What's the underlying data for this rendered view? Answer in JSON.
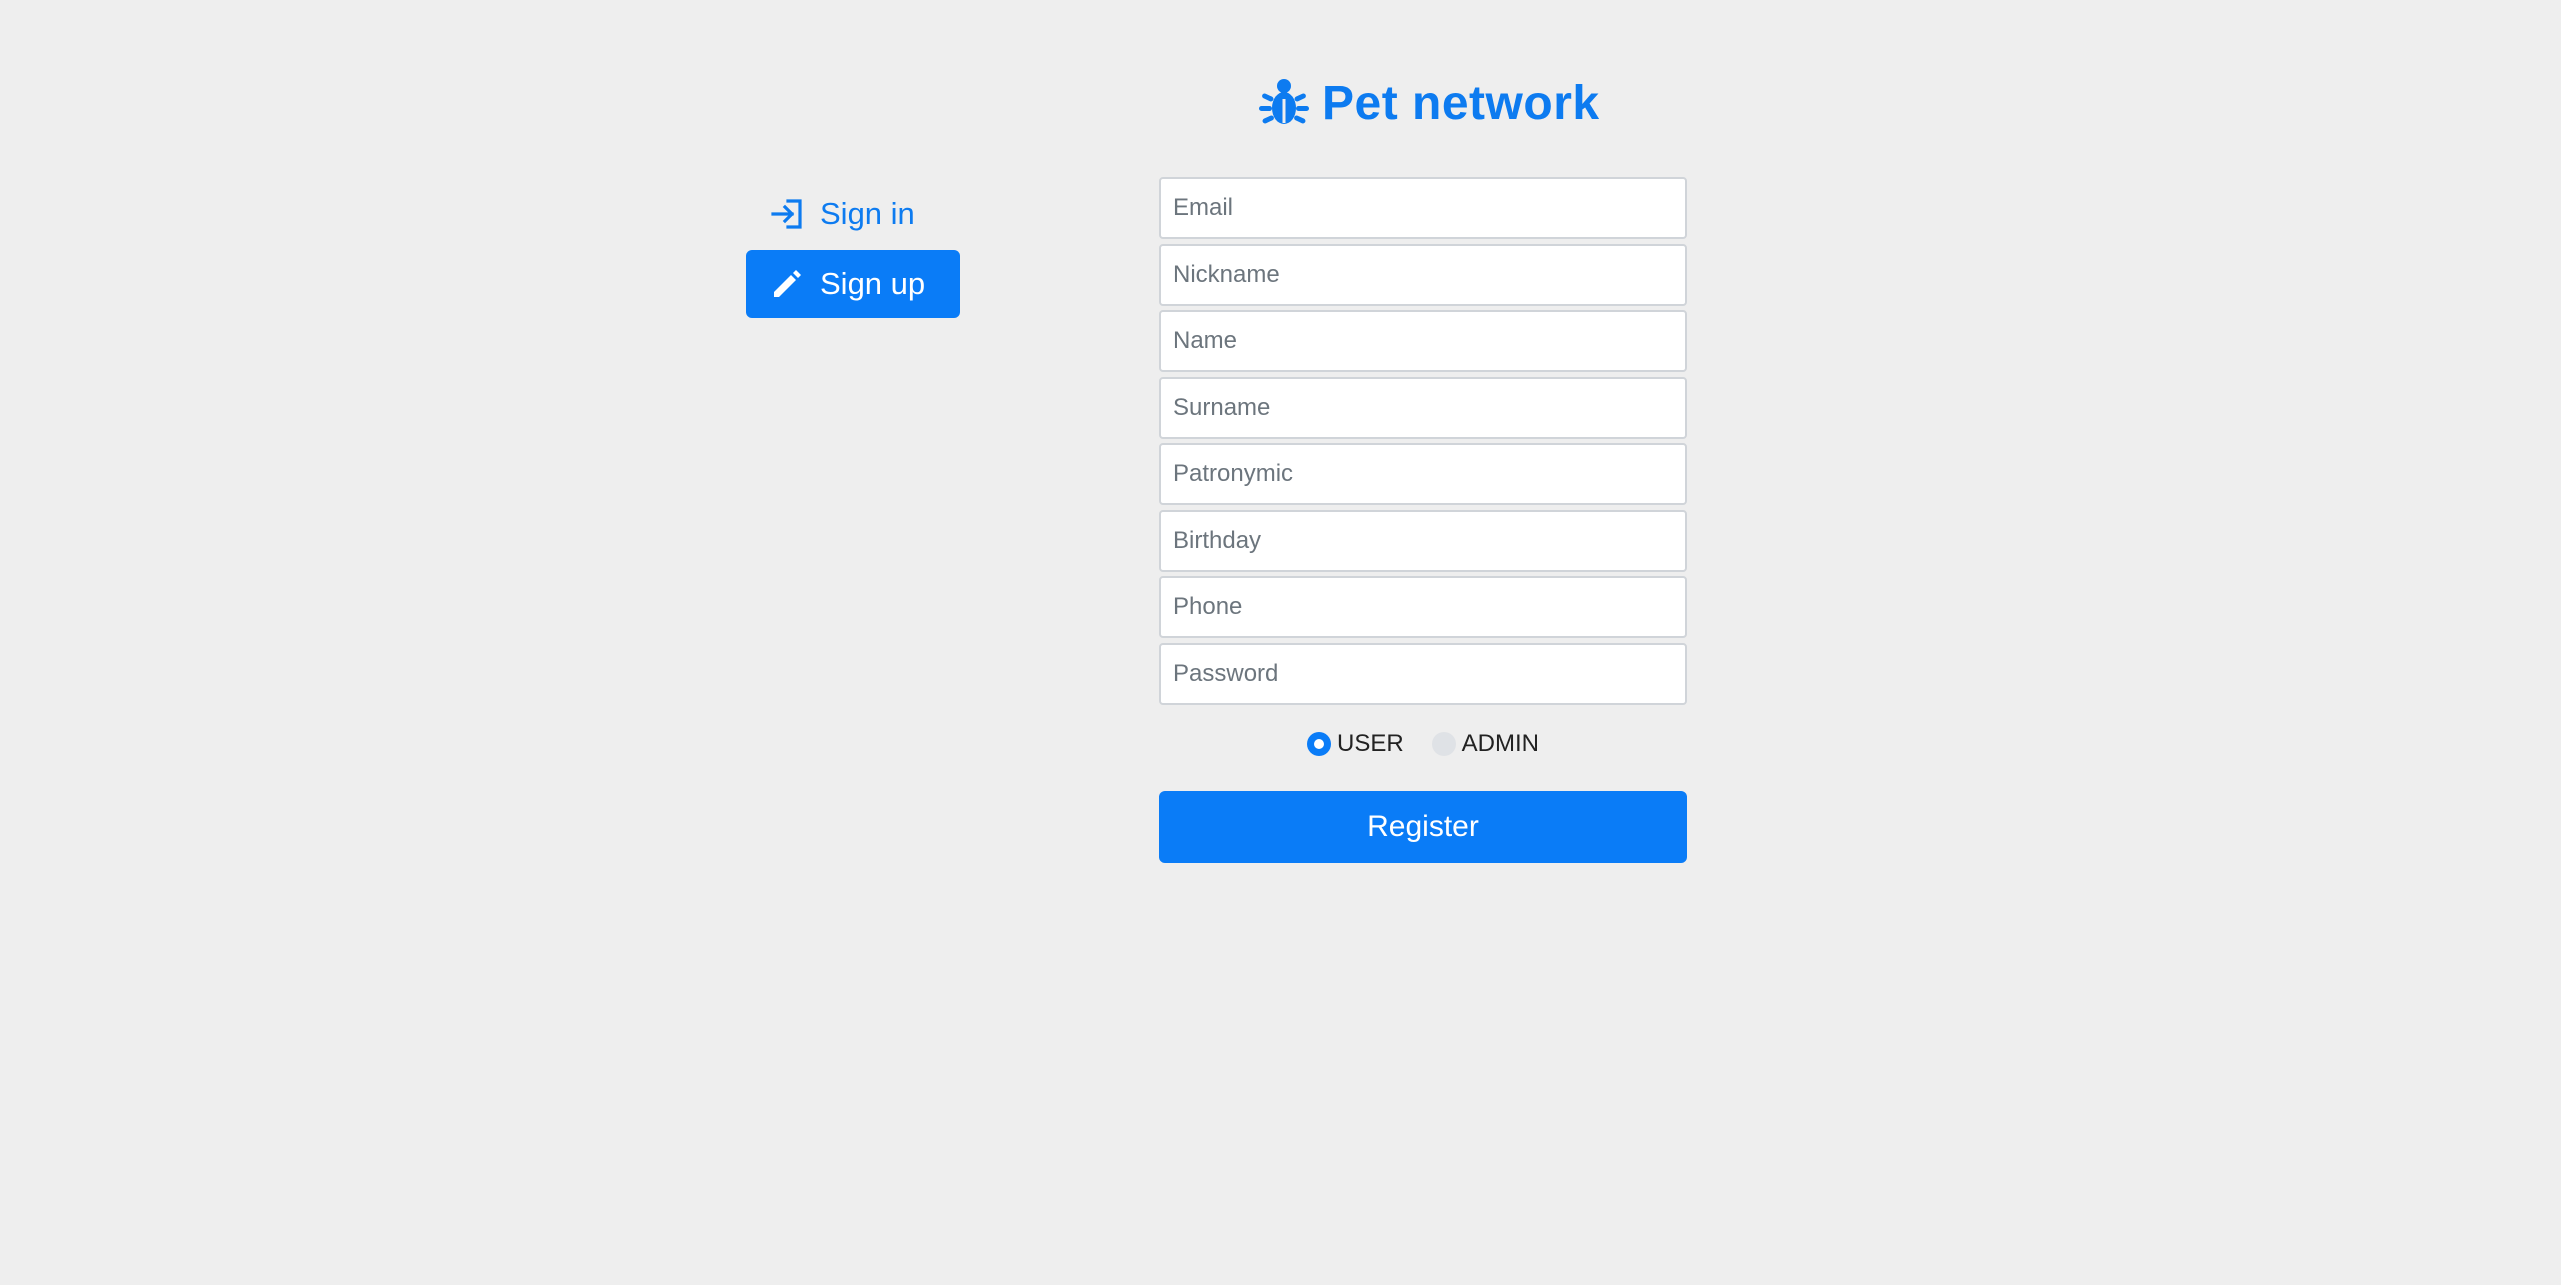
{
  "header": {
    "title": "Pet network",
    "icon": "bug-icon",
    "accent_color": "#0d7bf0"
  },
  "nav": {
    "items": [
      {
        "label": "Sign in",
        "icon": "sign-in-icon",
        "active": false
      },
      {
        "label": "Sign up",
        "icon": "pencil-icon",
        "active": true
      }
    ]
  },
  "form": {
    "fields": [
      {
        "placeholder": "Email",
        "value": ""
      },
      {
        "placeholder": "Nickname",
        "value": ""
      },
      {
        "placeholder": "Name",
        "value": ""
      },
      {
        "placeholder": "Surname",
        "value": ""
      },
      {
        "placeholder": "Patronymic",
        "value": ""
      },
      {
        "placeholder": "Birthday",
        "value": ""
      },
      {
        "placeholder": "Phone",
        "value": ""
      },
      {
        "placeholder": "Password",
        "value": ""
      }
    ],
    "roles": [
      {
        "label": "USER",
        "checked": true
      },
      {
        "label": "ADMIN",
        "checked": false
      }
    ],
    "submit_label": "Register",
    "primary_color": "#0a7cf7"
  }
}
